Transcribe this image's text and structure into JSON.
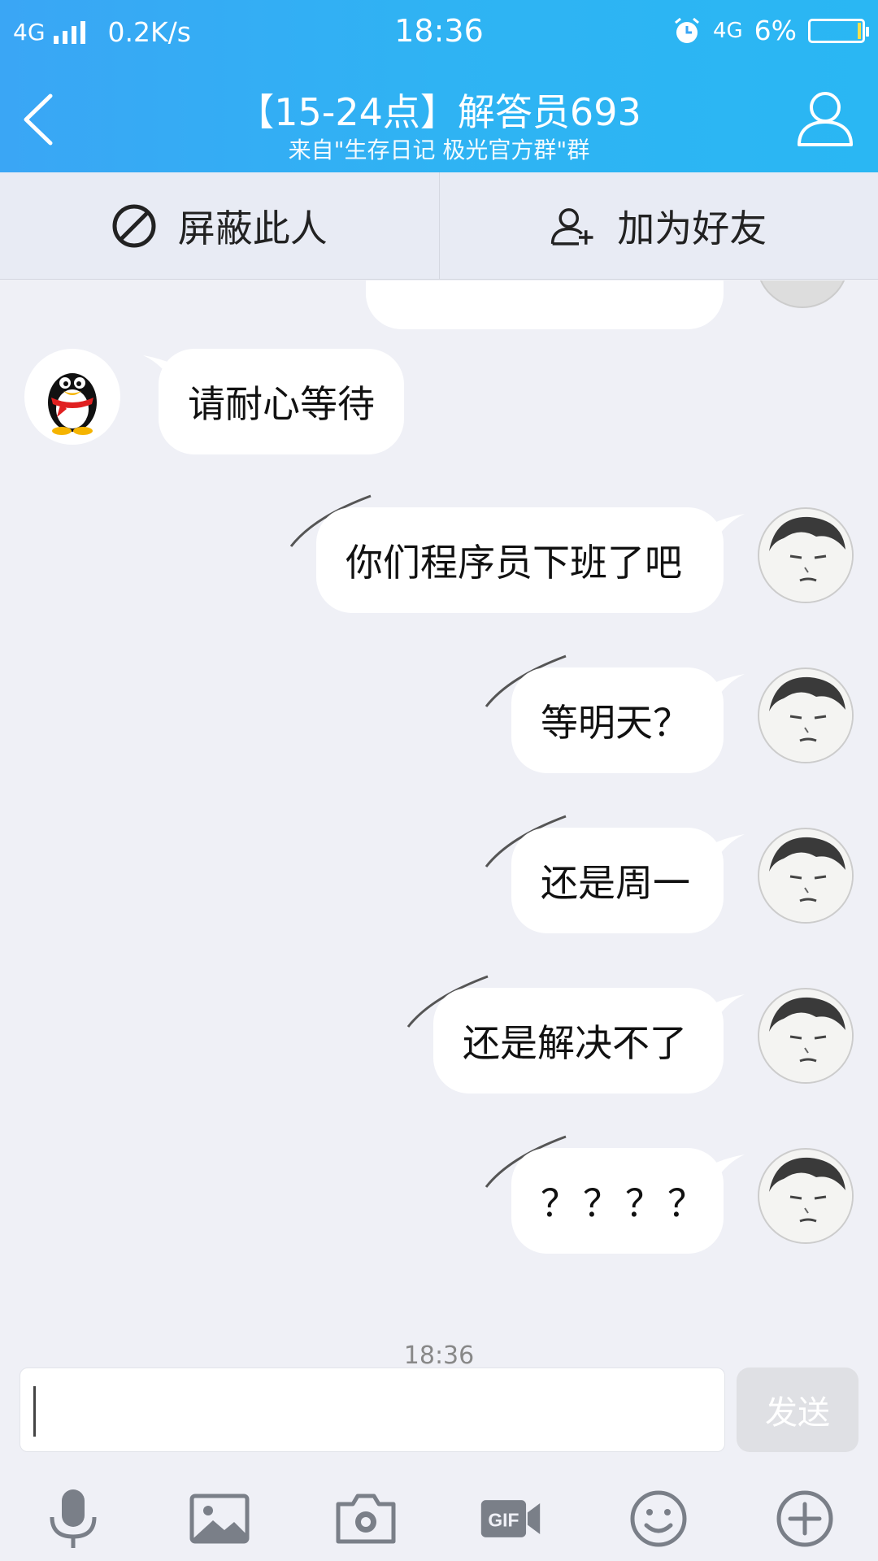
{
  "status_bar": {
    "network": "4G",
    "speed": "0.2K/s",
    "time": "18:36",
    "network_right": "4G",
    "battery": "6%"
  },
  "nav": {
    "title": "【15-24点】解答员693",
    "subtitle": "来自\"生存日记 极光官方群\"群"
  },
  "actions": {
    "block_label": "屏蔽此人",
    "add_friend_label": "加为好友"
  },
  "messages": [
    {
      "side": "received",
      "text": "请耐心等待"
    },
    {
      "side": "sent",
      "text": "你们程序员下班了吧"
    },
    {
      "side": "sent",
      "text": "等明天？"
    },
    {
      "side": "sent",
      "text": "还是周一"
    },
    {
      "side": "sent",
      "text": "还是解决不了"
    },
    {
      "side": "sent",
      "text": "？？？？"
    }
  ],
  "timestamp": "18:36",
  "input": {
    "value": "",
    "send_label": "发送"
  },
  "toolbar": {
    "icons": [
      "microphone-icon",
      "image-icon",
      "camera-icon",
      "gif-icon",
      "emoji-icon",
      "plus-icon"
    ]
  },
  "colors": {
    "header_gradient_start": "#3aa6f5",
    "header_gradient_end": "#2ab7f3",
    "chat_background": "#eff0f6",
    "bubble": "#ffffff",
    "icon_gray": "#7a7f88"
  }
}
